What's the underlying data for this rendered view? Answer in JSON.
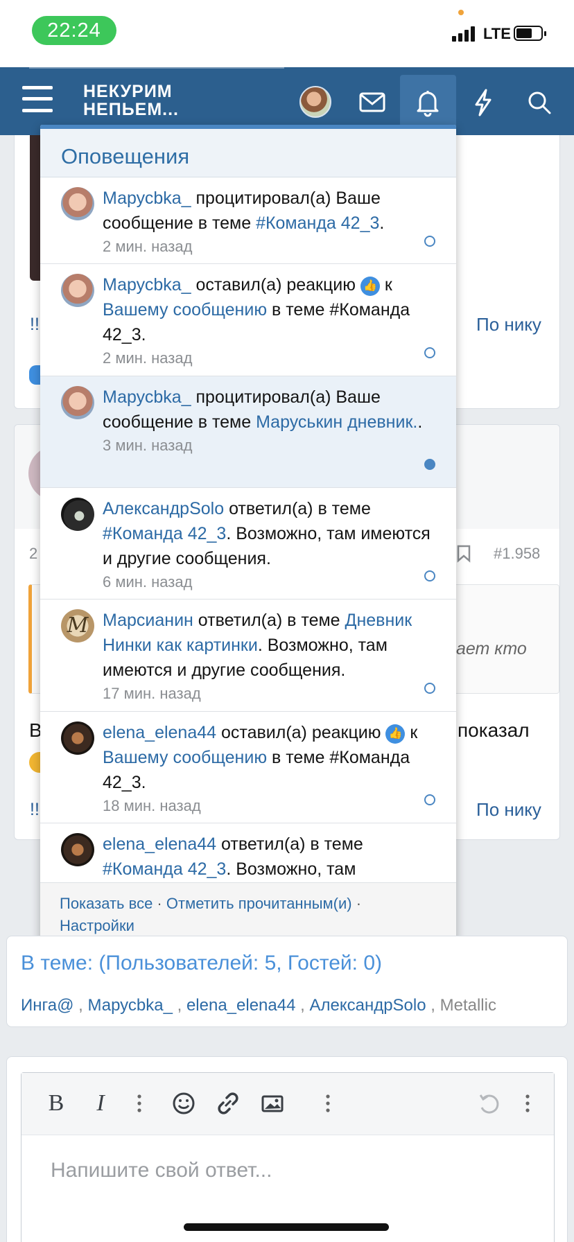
{
  "status_bar": {
    "time": "22:24",
    "network": "LTE"
  },
  "nav": {
    "logo_line1": "НЕКУРИМ",
    "logo_line2": "НЕПЬЕМ..."
  },
  "background": {
    "post_link_left": "!!",
    "by_nick": "По нику",
    "post_number": "#1.958",
    "post_num_left": "2",
    "quote_snippet": "ает кто",
    "text_fragment_left": "В",
    "text_fragment_right": "показал",
    "post_link_left_2": "!!",
    "by_nick_2": "По нику"
  },
  "notifications": {
    "title": "Оповещения",
    "items": [
      {
        "user": "Марусbka_",
        "action": " процитировал(а) Ваше сообщение в теме ",
        "target": "#Команда 42_3",
        "tail": ".",
        "time": "2 мин. назад"
      },
      {
        "user": "Марусbka_",
        "action": " оставил(а) реакцию ",
        "after_reaction": " к ",
        "link": "Вашему сообщению",
        "tail": " в теме #Команда 42_3.",
        "time": "2 мин. назад"
      },
      {
        "user": "Марусbka_",
        "action": " процитировал(а) Ваше сообщение в теме ",
        "target": "Маруськин дневник.",
        "tail": ".",
        "time": "3 мин. назад"
      },
      {
        "user": "АлександрSolo",
        "action": " ответил(а) в теме ",
        "target": "#Команда 42_3",
        "tail": ". Возможно, там имеются и другие сообщения.",
        "time": "6 мин. назад"
      },
      {
        "user": "Марсианин",
        "action": " ответил(а) в теме ",
        "target": "Дневник Нинки как картинки",
        "tail": ". Возможно, там имеются и другие сообщения.",
        "time": "17 мин. назад",
        "avatar_letter": "M"
      },
      {
        "user": "elena_elena44",
        "action": " оставил(а) реакцию ",
        "after_reaction": " к ",
        "link": "Вашему сообщению",
        "tail": " в теме #Команда 42_3.",
        "time": "18 мин. назад"
      },
      {
        "user": "elena_elena44",
        "action": " ответил(а) в теме ",
        "target": "#Команда 42_3",
        "tail": ". Возможно, там"
      }
    ],
    "footer": {
      "show_all": "Показать все",
      "sep1": " · ",
      "mark_read": "Отметить прочитанным(и)",
      "sep2": " ·",
      "settings": "Настройки"
    }
  },
  "members": {
    "title": "В теме: (Пользователей: 5, Гостей: 0)",
    "users": [
      "Инга@",
      "Марусbka_",
      "elena_elena44",
      "АлександрSolo"
    ],
    "sep": " , ",
    "guest_user": "Metallic"
  },
  "editor": {
    "placeholder": "Напишите свой ответ...",
    "bold_label": "B",
    "italic_label": "I"
  },
  "colors": {
    "nav_bg": "#2c5f8e",
    "link": "#2c6aa5",
    "status_green": "#3dc75a",
    "unread_bg": "#eaf1f8"
  }
}
